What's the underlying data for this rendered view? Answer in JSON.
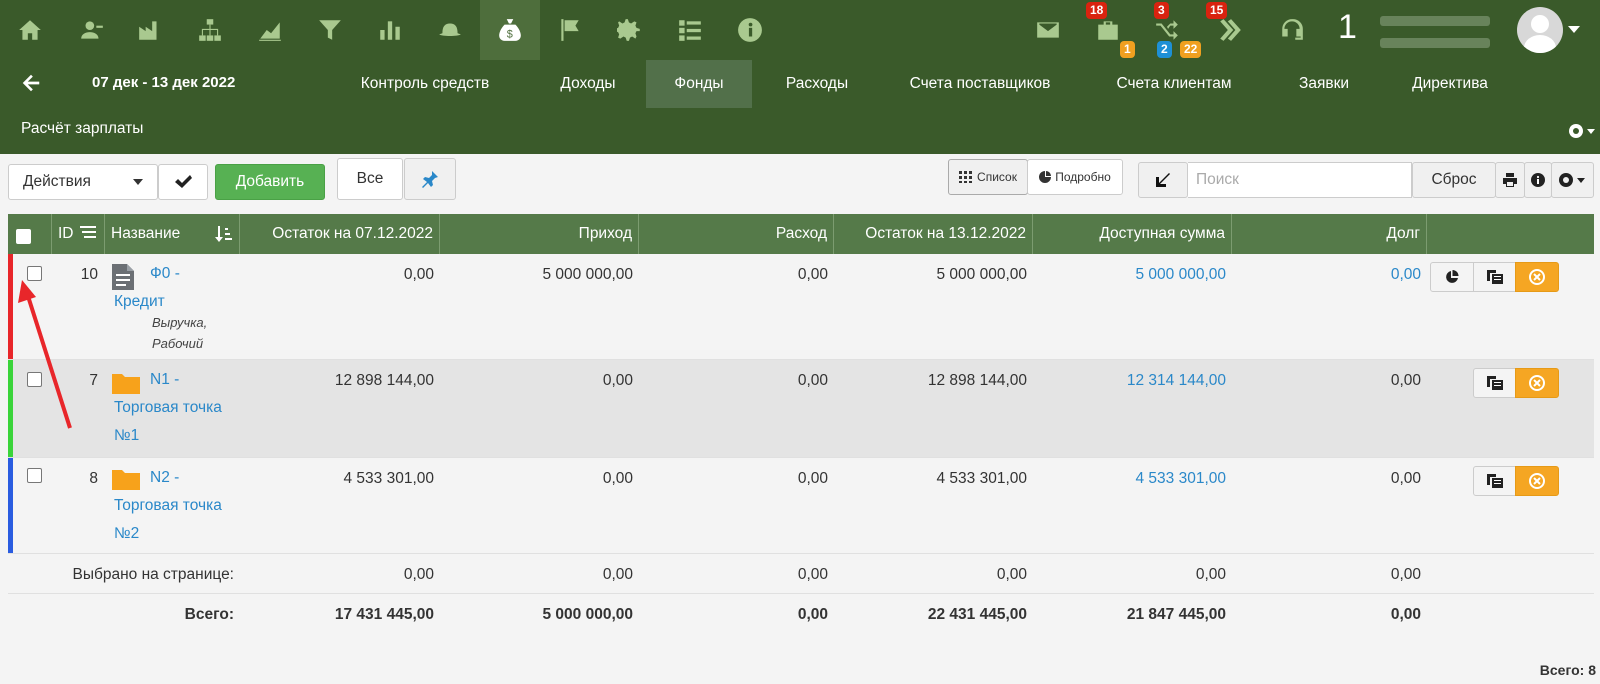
{
  "topnav": {
    "icons": [
      "home-icon",
      "contacts-icon",
      "factory-icon",
      "org-chart-icon",
      "area-chart-icon",
      "funnel-icon",
      "bar-chart-icon",
      "hat-icon",
      "money-bag-icon",
      "flag-icon",
      "gear-icon",
      "list-icon",
      "info-icon"
    ],
    "badges": {
      "briefcase": "18",
      "shuffle": "3",
      "forward": "15",
      "shuffle_orange": "1",
      "shuffle_blue": "2",
      "forward_orange": "22"
    },
    "user_count": "1"
  },
  "period": "07 дек - 13 дек 2022",
  "tabs": [
    {
      "label": "Контроль средств"
    },
    {
      "label": "Доходы"
    },
    {
      "label": "Фонды"
    },
    {
      "label": "Расходы"
    },
    {
      "label": "Счета поставщиков"
    },
    {
      "label": "Счета клиентам"
    },
    {
      "label": "Заявки"
    },
    {
      "label": "Директива"
    }
  ],
  "subtab": "Расчёт зарплаты",
  "toolbar": {
    "actions_label": "Действия",
    "add_label": "Добавить",
    "filter_all": "Все",
    "view_list": "Список",
    "view_detail": "Подробно",
    "search_placeholder": "Поиск",
    "reset_label": "Сброс"
  },
  "columns": {
    "id": "ID",
    "name": "Название",
    "balance_start": "Остаток на 07.12.2022",
    "income": "Приход",
    "expense": "Расход",
    "balance_end": "Остаток на 13.12.2022",
    "available": "Доступная сумма",
    "debt": "Долг"
  },
  "rows": [
    {
      "id": "10",
      "name_line1": "Ф0 -",
      "name_line2": "Кредит",
      "name_line3": "",
      "tags_line1": "Выручка,",
      "tags_line2": "Рабочий",
      "balance_start": "0,00",
      "income": "5 000 000,00",
      "expense": "0,00",
      "balance_end": "5 000 000,00",
      "available": "5 000 000,00",
      "debt": "0,00",
      "color": "#e8262a",
      "icon": "document-icon"
    },
    {
      "id": "7",
      "name_line1": "N1 -",
      "name_line2": "Торговая точка",
      "name_line3": "№1",
      "balance_start": "12 898 144,00",
      "income": "0,00",
      "expense": "0,00",
      "balance_end": "12 898 144,00",
      "available": "12 314 144,00",
      "debt": "0,00",
      "color": "#3ad43a",
      "icon": "folder-icon"
    },
    {
      "id": "8",
      "name_line1": "N2 -",
      "name_line2": "Торговая точка",
      "name_line3": "№2",
      "balance_start": "4 533 301,00",
      "income": "0,00",
      "expense": "0,00",
      "balance_end": "4 533 301,00",
      "available": "4 533 301,00",
      "debt": "0,00",
      "color": "#2a5ce0",
      "icon": "folder-icon"
    }
  ],
  "selected": {
    "label": "Выбрано на странице:",
    "balance_start": "0,00",
    "income": "0,00",
    "expense": "0,00",
    "balance_end": "0,00",
    "available": "0,00",
    "debt": "0,00"
  },
  "total": {
    "label": "Всего:",
    "balance_start": "17 431 445,00",
    "income": "5 000 000,00",
    "expense": "0,00",
    "balance_end": "22 431 445,00",
    "available": "21 847 445,00",
    "debt": "0,00"
  },
  "footer": "Всего: 8",
  "colors": {
    "nav_bg": "#3a5a2a",
    "header_bg": "#557a49",
    "link": "#2a88c9",
    "add_button": "#57b153",
    "action_orange": "#f5a623",
    "annotation_arrow": "#e8262a"
  }
}
